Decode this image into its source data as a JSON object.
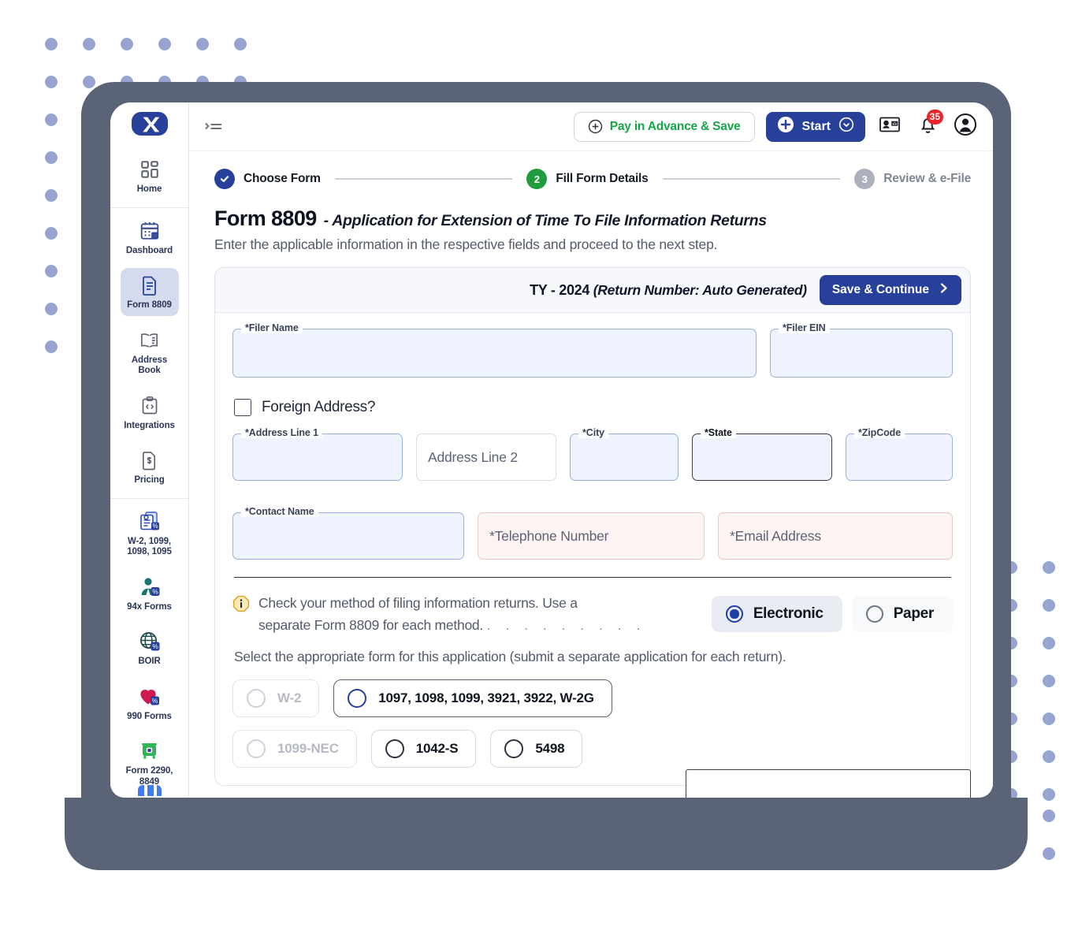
{
  "app": {
    "brand_icon": "x-logo-icon"
  },
  "topbar": {
    "menu_icon": "menu-collapse-icon",
    "pay_in_advance_label": "Pay in Advance & Save",
    "start_label": "Start",
    "contacts_icon": "contact-card-icon",
    "bell_icon": "bell-icon",
    "notification_count": "35",
    "account_icon": "account-circle-icon"
  },
  "sidebar": {
    "groups": [
      {
        "items": [
          {
            "label": "Home",
            "icon": "grid-dashboard-icon",
            "active": false
          }
        ]
      },
      {
        "items": [
          {
            "label": "Dashboard",
            "icon": "calendar-tax-icon",
            "active": false
          },
          {
            "label": "Form 8809",
            "icon": "document-icon",
            "active": true
          },
          {
            "label": "Address Book",
            "icon": "address-book-icon",
            "active": false
          },
          {
            "label": "Integrations",
            "icon": "code-clipboard-icon",
            "active": false
          },
          {
            "label": "Pricing",
            "icon": "dollar-document-icon",
            "active": false
          }
        ]
      },
      {
        "items": [
          {
            "label": "W-2, 1099, 1098, 1095",
            "icon": "tax-forms-icon",
            "active": false
          },
          {
            "label": "94x Forms",
            "icon": "person-tax-icon",
            "active": false
          },
          {
            "label": "BOIR",
            "icon": "globe-tax-icon",
            "active": false
          },
          {
            "label": "990 Forms",
            "icon": "heart-tax-icon",
            "active": false
          },
          {
            "label": "Form 2290, 8849",
            "icon": "truck-tax-icon",
            "active": false
          }
        ]
      }
    ]
  },
  "stepper": {
    "steps": [
      {
        "badge": "✓",
        "label": "Choose Form",
        "state": "done"
      },
      {
        "badge": "2",
        "label": "Fill Form Details",
        "state": "current"
      },
      {
        "badge": "3",
        "label": "Review & e-File",
        "state": "todo"
      }
    ]
  },
  "page": {
    "title": "Form 8809",
    "subtitle": "- Application for Extension of Time To File Information Returns",
    "hint": "Enter the applicable information in the respective fields and proceed to the next step."
  },
  "card": {
    "ty_label": "TY - 2024",
    "ty_note": "(Return Number: Auto Generated)",
    "save_continue_label": "Save & Continue",
    "save_continue_icon": "chevron-right-icon"
  },
  "fields": {
    "filer_name": {
      "legend": "*Filer Name",
      "value": ""
    },
    "filer_ein": {
      "legend": "*Filer EIN",
      "value": ""
    },
    "foreign_address": {
      "label": "Foreign Address?",
      "checked": false
    },
    "address_line_1": {
      "legend": "*Address Line 1",
      "value": ""
    },
    "address_line_2": {
      "placeholder": "Address Line 2",
      "value": ""
    },
    "city": {
      "legend": "*City",
      "value": ""
    },
    "state": {
      "legend": "*State",
      "value": "",
      "focused": true
    },
    "zipcode": {
      "legend": "*ZipCode",
      "value": ""
    },
    "contact_name": {
      "legend": "*Contact Name",
      "value": ""
    },
    "telephone_number": {
      "placeholder": "*Telephone Number",
      "value": ""
    },
    "email_address": {
      "placeholder": "*Email Address",
      "value": ""
    }
  },
  "method": {
    "info_icon": "info-icon",
    "note_line_1": "Check your method of filing information returns. Use a",
    "note_line_2": "separate Form 8809 for each method.",
    "dot_leader": ". . . . . . . . .",
    "options": [
      {
        "label": "Electronic",
        "selected": true
      },
      {
        "label": "Paper",
        "selected": false
      }
    ]
  },
  "form_selection": {
    "instruction": "Select the appropriate form for this application (submit a separate application for each return).",
    "row1": [
      {
        "label": "W-2",
        "state": "disabled"
      },
      {
        "label": "1097, 1098, 1099, 3921, 3922, W-2G",
        "state": "highlighted"
      }
    ],
    "row2": [
      {
        "label": "1099-NEC",
        "state": "disabled"
      },
      {
        "label": "1042-S",
        "state": "normal"
      },
      {
        "label": "5498",
        "state": "normal"
      }
    ]
  },
  "colors": {
    "brand_blue": "#27419b",
    "green_accent": "#17a64a",
    "step_current_green": "#1f9d3e",
    "badge_red": "#e8252a",
    "frame_gray": "#5b6377",
    "dot_violet": "#97a3d0"
  }
}
